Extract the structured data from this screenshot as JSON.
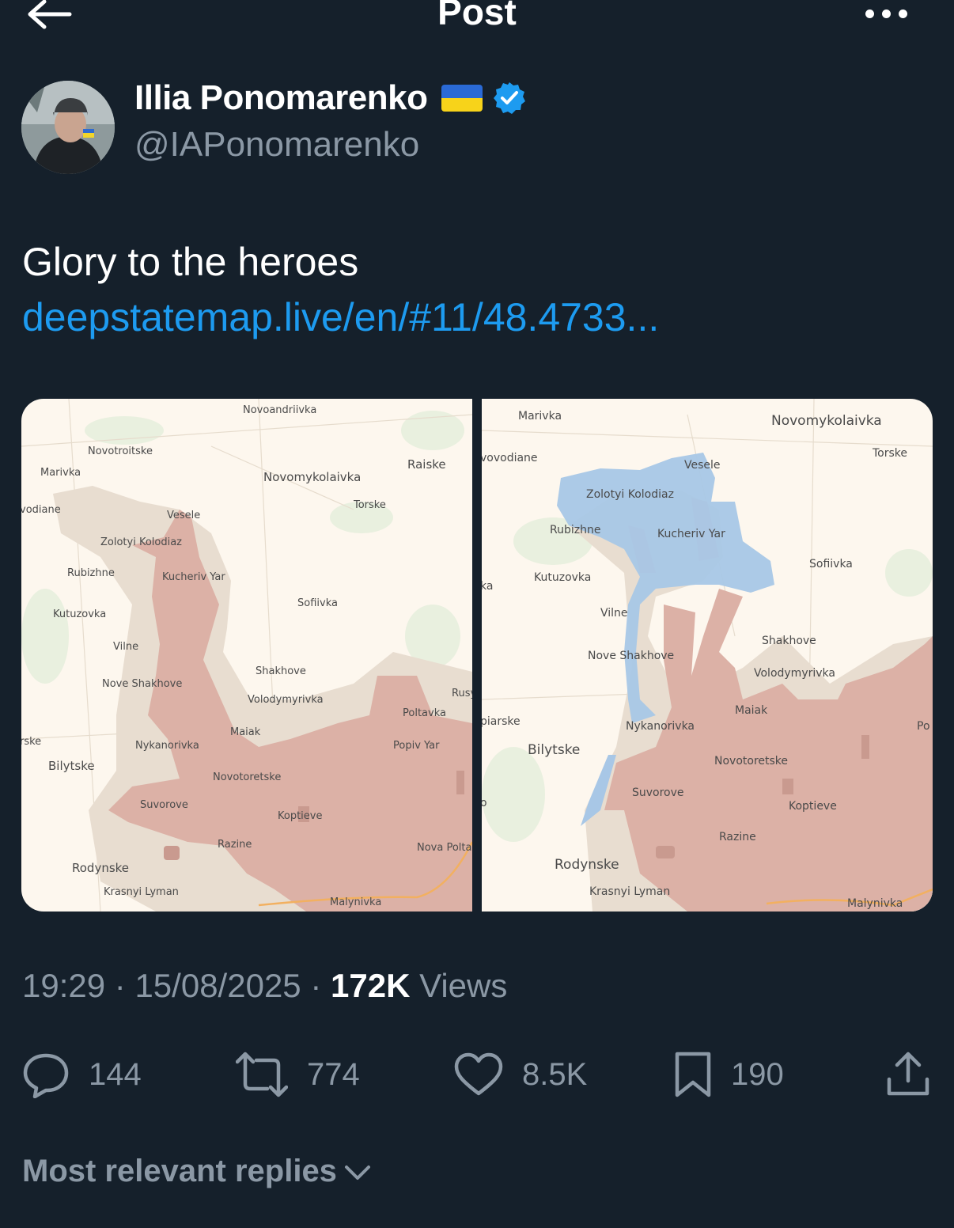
{
  "header": {
    "title": "Post",
    "back_icon": "arrow-left-icon",
    "more_icon": "more-dots-icon"
  },
  "author": {
    "name": "Illia Ponomarenko",
    "handle": "@IAPonomarenko",
    "flag": "ukraine-flag-icon",
    "verified_icon": "verified-badge-icon",
    "verified_color": "#1d9bf0"
  },
  "post": {
    "text": "Glory to the heroes",
    "link": "deepstatemap.live/en/#11/48.4733..."
  },
  "map_left": {
    "labels": [
      "Novoandriivka",
      "Novotroitske",
      "Marivka",
      "Raiske",
      "Novomykolaivka",
      "vodiane",
      "Torske",
      "Vesele",
      "Zolotyi Kolodiaz",
      "Rubizhne",
      "Kucheriv Yar",
      "Kutuzovka",
      "Sofiivka",
      "Vilne",
      "Shakhove",
      "Nove Shakhove",
      "Volodymyrivka",
      "Rusy",
      "Poltavka",
      "Maiak",
      "rske",
      "Nykanorivka",
      "Popiv Yar",
      "Bilytske",
      "Novotoretske",
      "Suvorove",
      "Koptieve",
      "Razine",
      "Nova Polta",
      "Rodynske",
      "Krasnyi Lyman",
      "Malynivka"
    ]
  },
  "map_right": {
    "labels": [
      "Marivka",
      "Novomykolaivka",
      "Torske",
      "vovodiane",
      "Vesele",
      "Zolotyi Kolodiaz",
      "Rubizhne",
      "Kucheriv Yar",
      "Sofiivka",
      "Kutuzovka",
      "ka",
      "Vilne",
      "Shakhove",
      "Nove Shakhove",
      "Volodymyrivka",
      "Maiak",
      "piarske",
      "Nykanorivka",
      "Po",
      "Bilytske",
      "Novotoretske",
      "Suvorove",
      "o",
      "Koptieve",
      "Razine",
      "Rodynske",
      "Krasnyi Lyman",
      "Malynivka"
    ]
  },
  "meta": {
    "time": "19:29",
    "sep1": "·",
    "date": "15/08/2025",
    "sep2": "·",
    "views_count": "172K",
    "views_label": "Views"
  },
  "actions": {
    "replies": "144",
    "reposts": "774",
    "likes": "8.5K",
    "bookmarks": "190"
  },
  "replies_filter": {
    "label": "Most relevant replies",
    "icon": "chevron-down-icon"
  },
  "colors": {
    "background": "#15202b",
    "secondary_text": "#8b98a5",
    "link": "#1d9bf0",
    "map_base": "#fdf7ee",
    "map_grey_zone": "#e8ddd0",
    "map_red_zone": "#dcb1a6",
    "map_blue_zone": "#a8c7e6"
  }
}
